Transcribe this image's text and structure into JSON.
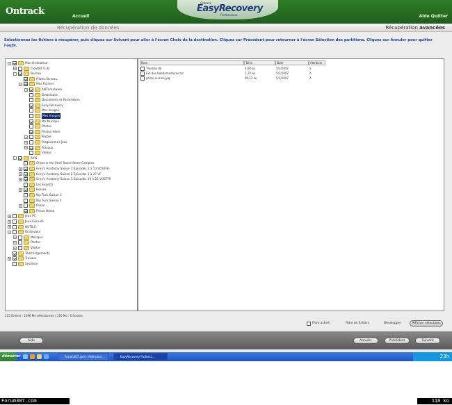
{
  "header": {
    "brand": "Ontrack",
    "home": "Accueil",
    "logo_small": "Ontrack",
    "logo_main": "EasyRecovery",
    "logo_edition": "Professional",
    "help_quit": "Aide Quitter"
  },
  "subbar": {
    "title": "Récupération de données",
    "mode_prefix": "Récupération",
    "mode_bold": "avancées"
  },
  "instructions": "Sélectionnez les fichiers à récupérer, puis cliquez sur Suivant pour aller à l'écran Choix de la destination. Cliquez sur Précédent pour retourner à l'écran Sélection des partitions. Cliquez sur Annuler pour quitter l'outil.",
  "tree": [
    {
      "label": "Mon Ordinateur",
      "level": 0,
      "exp": "-",
      "checked": true
    },
    {
      "label": "CleaRAT 0.dir",
      "level": 1,
      "exp": "+",
      "checked": false
    },
    {
      "label": "Bureau",
      "level": 1,
      "exp": "-",
      "checked": true
    },
    {
      "label": "Pilotes Bureau",
      "level": 2,
      "exp": "",
      "checked": true
    },
    {
      "label": "Mes Fichiers",
      "level": 2,
      "exp": "-",
      "checked": true
    },
    {
      "label": "ANTI-malware",
      "level": 3,
      "exp": "+",
      "checked": true
    },
    {
      "label": "Downloads",
      "level": 3,
      "exp": "",
      "checked": false
    },
    {
      "label": "Documents et Paramètres",
      "level": 3,
      "exp": "",
      "checked": false
    },
    {
      "label": "Easy Recovery",
      "level": 3,
      "exp": "",
      "checked": true
    },
    {
      "label": "Mes Images",
      "level": 3,
      "exp": "",
      "checked": false
    },
    {
      "label": "Mes Images",
      "level": 3,
      "exp": "",
      "checked": false,
      "selected": true
    },
    {
      "label": "Ma Musique",
      "level": 3,
      "exp": "",
      "checked": true
    },
    {
      "label": "Photos",
      "level": 3,
      "exp": "",
      "checked": false
    },
    {
      "label": "Photos Hiver",
      "level": 3,
      "exp": "",
      "checked": true
    },
    {
      "label": "Pilotes",
      "level": 3,
      "exp": "+",
      "checked": false
    },
    {
      "label": "Programmes Jeux",
      "level": 3,
      "exp": "+",
      "checked": false
    },
    {
      "label": "Travaux",
      "level": 3,
      "exp": "+",
      "checked": true
    },
    {
      "label": "Vidéos",
      "level": 3,
      "exp": "",
      "checked": false
    },
    {
      "label": "AVIS",
      "level": 1,
      "exp": "-",
      "checked": true
    },
    {
      "label": "Ghost in the Shell Stand Alone Complex",
      "level": 2,
      "exp": "",
      "checked": false
    },
    {
      "label": "Grey's Anatomy Saison 3 Episodes 1 à 13 VOSTFR",
      "level": 2,
      "exp": "+",
      "checked": true
    },
    {
      "label": "Grey's Anatomy Saison 2 Episodes 1 à 27 VF",
      "level": 2,
      "exp": "+",
      "checked": true
    },
    {
      "label": "Grey's Anatomy Saison 3 Episodes 14 à 25 VOSTFR",
      "level": 2,
      "exp": "+",
      "checked": true
    },
    {
      "label": "Les Experts",
      "level": 2,
      "exp": "",
      "checked": false
    },
    {
      "label": "Heroes",
      "level": 2,
      "exp": "+",
      "checked": true
    },
    {
      "label": "Nip Tuck Saison 3",
      "level": 2,
      "exp": "",
      "checked": false
    },
    {
      "label": "Nip Tuck Saison 4",
      "level": 2,
      "exp": "",
      "checked": false
    },
    {
      "label": "Prison",
      "level": 2,
      "exp": "+",
      "checked": false
    },
    {
      "label": "Prison Break",
      "level": 2,
      "exp": "",
      "checked": true
    },
    {
      "label": "Jeux PC",
      "level": 0,
      "exp": "+",
      "checked": false
    },
    {
      "label": "Jeux Console",
      "level": 0,
      "exp": "+",
      "checked": false
    },
    {
      "label": "OUTILS",
      "level": 0,
      "exp": "+",
      "checked": false
    },
    {
      "label": "Ordinateur",
      "level": 0,
      "exp": "-",
      "checked": false
    },
    {
      "label": "Musique",
      "level": 1,
      "exp": "+",
      "checked": false
    },
    {
      "label": "Photos",
      "level": 1,
      "exp": "+",
      "checked": false
    },
    {
      "label": "Vidéos",
      "level": 1,
      "exp": "+",
      "checked": false
    },
    {
      "label": "Téléchargements",
      "level": 0,
      "exp": "",
      "checked": true
    },
    {
      "label": "Travaux",
      "level": 0,
      "exp": "+",
      "checked": true
    },
    {
      "label": "Système",
      "level": 0,
      "exp": "",
      "checked": false
    }
  ],
  "files": {
    "columns": [
      "Nom",
      "Taille",
      "Date",
      "Attributs"
    ],
    "rows": [
      {
        "name": "Thumbs.db",
        "size": "4,00 ko",
        "date": "5/1/2007",
        "attr": "S"
      },
      {
        "name": "Ext des hebdomadaires.txt",
        "size": "1,72 ko",
        "date": "5/1/2007",
        "attr": "A"
      },
      {
        "name": "photo cuisine.jpg",
        "size": "89,12 ko",
        "date": "5/1/2007",
        "attr": "A"
      }
    ]
  },
  "status": "115 fichiers : 1096 Mo sélectionnés   |   310 Mo : 6 fichiers",
  "filter": {
    "checkbox_label": "Filtre activé",
    "file_filter": "Filtre de fichiers",
    "expand": "Développer",
    "fixed_options": "Afficher sélections"
  },
  "buttons": {
    "help": "Aide",
    "cancel": "Annuler",
    "previous": "Précédent",
    "next": "Suivant"
  },
  "taskbar": {
    "start": "démarrer",
    "task1": "Forum307.com - Aide pour...",
    "task2": "EasyRecovery Professi...",
    "clock": "23h"
  },
  "footer": {
    "left": "Forum307.com",
    "right": "110 ko"
  }
}
